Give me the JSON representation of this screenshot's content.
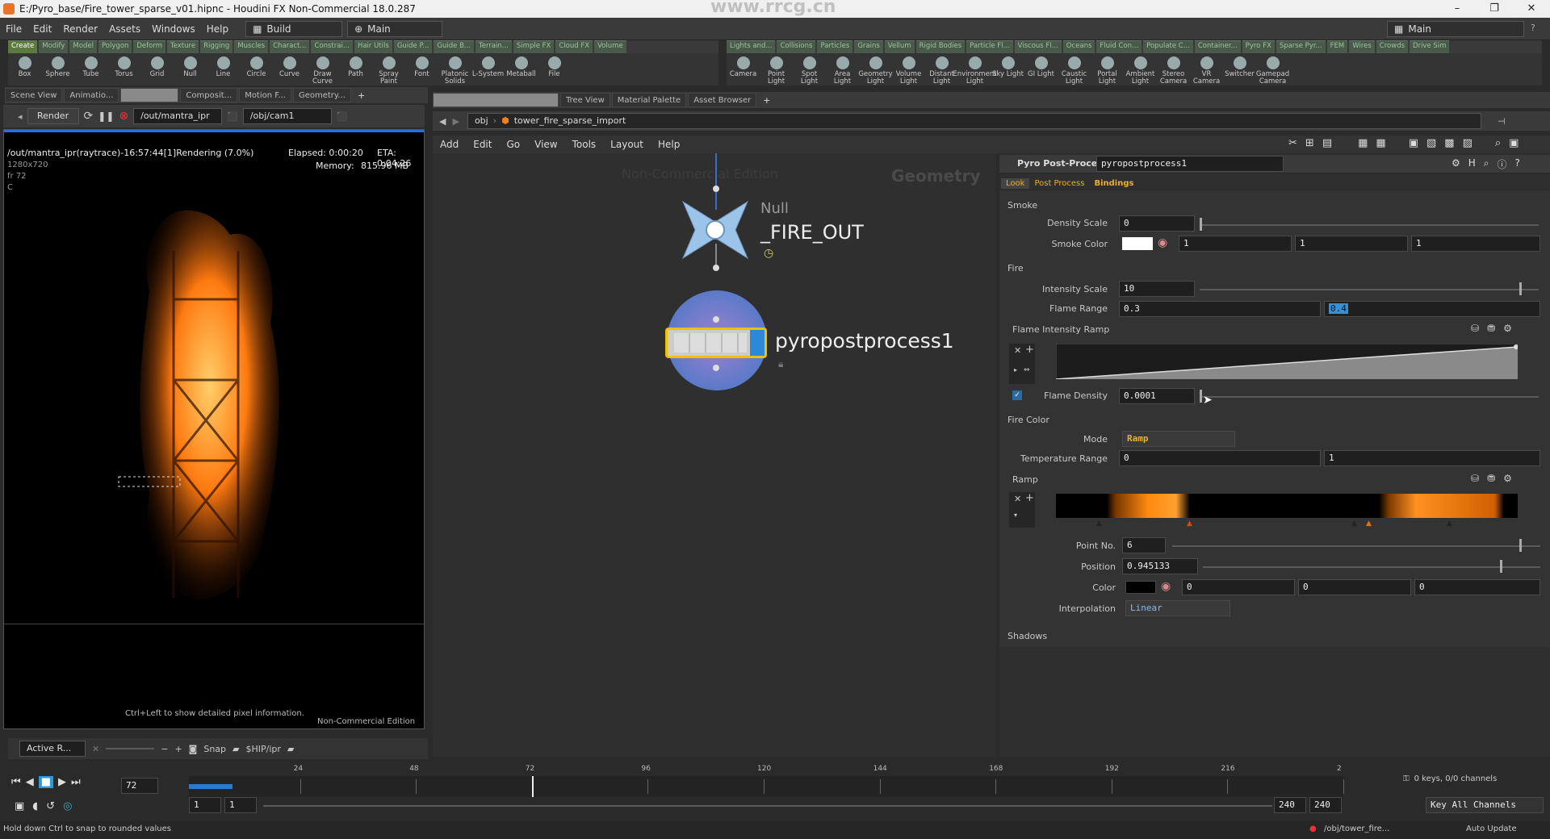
{
  "window": {
    "title": "E:/Pyro_base/Fire_tower_sparse_v01.hipnc - Houdini FX Non-Commercial 18.0.287",
    "watermark": "www.rrcg.cn"
  },
  "menubar": {
    "items": [
      "File",
      "Edit",
      "Render",
      "Assets",
      "Windows",
      "Help"
    ],
    "desktop_label": "Build",
    "desktop_right": "Main"
  },
  "shelf_left": {
    "tabs": [
      "Create",
      "Modify",
      "Model",
      "Polygon",
      "Deform",
      "Texture",
      "Rigging",
      "Muscles",
      "Charact...",
      "Constrai...",
      "Hair Utils",
      "Guide P...",
      "Guide B...",
      "Terrain...",
      "Simple FX",
      "Cloud FX",
      "Volume"
    ],
    "tools": [
      "Box",
      "Sphere",
      "Tube",
      "Torus",
      "Grid",
      "Null",
      "Line",
      "Circle",
      "Curve",
      "Draw Curve",
      "Path",
      "Spray Paint",
      "Font",
      "Platonic Solids",
      "L-System",
      "Metaball",
      "File"
    ]
  },
  "shelf_right": {
    "tabs": [
      "Lights and...",
      "Collisions",
      "Particles",
      "Grains",
      "Vellum",
      "Rigid Bodies",
      "Particle Fl...",
      "Viscous Fl...",
      "Oceans",
      "Fluid Con...",
      "Populate C...",
      "Container...",
      "Pyro FX",
      "Sparse Pyr...",
      "FEM",
      "Wires",
      "Crowds",
      "Drive Sim"
    ],
    "tools": [
      "Camera",
      "Point Light",
      "Spot Light",
      "Area Light",
      "Geometry Light",
      "Volume Light",
      "Distant Light",
      "Environment Light",
      "Sky Light",
      "GI Light",
      "Caustic Light",
      "Portal Light",
      "Ambient Light",
      "Stereo Camera",
      "VR Camera",
      "Switcher",
      "Gamepad Camera"
    ]
  },
  "left_panetabs": [
    "Scene View",
    "Animatio...",
    "",
    "Composit...",
    "Motion F...",
    "Geometry..."
  ],
  "right_panetabs": [
    "",
    "Tree View",
    "Material Palette",
    "Asset Browser"
  ],
  "render": {
    "button": "Render",
    "output": "/out/mantra_ipr",
    "camera": "/obj/cam1",
    "status": "/out/mantra_ipr(raytrace)-16:57:44[1]Rendering (7.0%)",
    "elapsed": "Elapsed: 0:00:20",
    "eta": "ETA: 0:04:26",
    "memory": "Memory:",
    "memory_val": "815.96 MB",
    "resolution": "1280x720",
    "frame": "fr 72",
    "channel": "C",
    "hint": "Ctrl+Left to show detailed pixel information.",
    "edition": "Non-Commercial Edition",
    "bottom_label": "Active R...",
    "snap_label": "Snap",
    "ship_label": "$HIP/ipr"
  },
  "network": {
    "path_root": "obj",
    "path_node": "tower_fire_sparse_import",
    "menu": [
      "Add",
      "Edit",
      "Go",
      "View",
      "Tools",
      "Layout",
      "Help"
    ],
    "watermark_edition": "Non-Commercial Edition",
    "context_label": "Geometry",
    "null_type": "Null",
    "null_name": "_FIRE_OUT",
    "pyro_name": "pyropostprocess1"
  },
  "parms": {
    "node_type": "Pyro Post-Process",
    "node_name": "pyropostprocess1",
    "tabs": [
      "Look",
      "Post Process",
      "Bindings"
    ],
    "smoke_section": "Smoke",
    "density_scale_label": "Density Scale",
    "density_scale": "0",
    "smoke_color_label": "Smoke Color",
    "smoke_color": [
      "1",
      "1",
      "1"
    ],
    "fire_section": "Fire",
    "intensity_scale_label": "Intensity Scale",
    "intensity_scale": "10",
    "flame_range_label": "Flame Range",
    "flame_range_min": "0.3",
    "flame_range_max": "0.4",
    "flame_ramp_label": "Flame Intensity Ramp",
    "flame_density_label": "Flame Density",
    "flame_density": "0.0001",
    "fire_color_label": "Fire Color",
    "mode_label": "Mode",
    "mode": "Ramp",
    "temp_range_label": "Temperature Range",
    "temp_range": [
      "0",
      "1"
    ],
    "ramp_label": "Ramp",
    "point_no_label": "Point No.",
    "point_no": "6",
    "position_label": "Position",
    "position": "0.945133",
    "color_label": "Color",
    "color": [
      "0",
      "0",
      "0"
    ],
    "interp_label": "Interpolation",
    "interp": "Linear",
    "shadows_label": "Shadows"
  },
  "timeline": {
    "current_frame": "72",
    "ticks": [
      "24",
      "48",
      "72",
      "96",
      "120",
      "144",
      "168",
      "192",
      "216",
      "2"
    ],
    "start": "1",
    "start2": "1",
    "end": "240",
    "end2": "240",
    "keys_info": "0 keys, 0/0 channels",
    "key_all": "Key All Channels",
    "auto_update": "Auto Update",
    "obj_path": "/obj/tower_fire..."
  },
  "status": {
    "hint": "Hold down Ctrl to snap to rounded values"
  },
  "colors": {
    "accent": "#f0a030",
    "node_select": "#f0c000",
    "fire": "#ff7a10"
  }
}
